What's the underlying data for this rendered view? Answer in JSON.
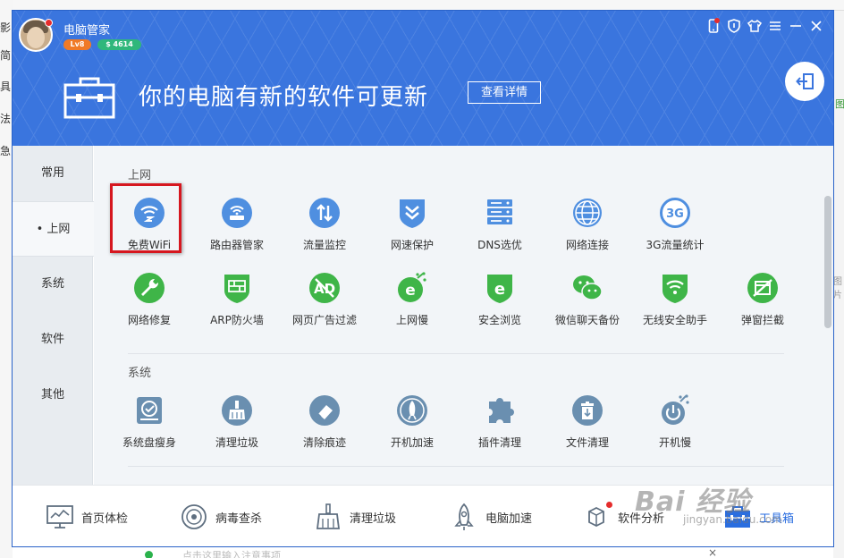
{
  "background": {
    "left_chars": [
      "影",
      "简",
      "具",
      "法",
      "急"
    ],
    "right_chars": [
      "图",
      "图片"
    ],
    "bottom_input_placeholder": "点击这里输入注意事项",
    "bottom_close": "×"
  },
  "header": {
    "app_title": "电脑管家",
    "level": "Lv8",
    "coins": "$ 4614",
    "banner_text": "你的电脑有新的软件可更新",
    "detail_button": "查看详情",
    "window_controls": [
      "phone-icon",
      "shield-icon",
      "skin-icon",
      "menu-icon",
      "minimize-icon",
      "close-icon"
    ]
  },
  "sidebar": {
    "tabs": [
      {
        "label": "常用",
        "active": false
      },
      {
        "label": "• 上网",
        "active": true
      },
      {
        "label": "系统",
        "active": false
      },
      {
        "label": "软件",
        "active": false
      },
      {
        "label": "其他",
        "active": false
      }
    ]
  },
  "content": {
    "sections": [
      {
        "title": "上网",
        "items": [
          {
            "label": "免费WiFi",
            "icon": "wifi-icon"
          },
          {
            "label": "路由器管家",
            "icon": "router-icon"
          },
          {
            "label": "流量监控",
            "icon": "traffic-icon"
          },
          {
            "label": "网速保护",
            "icon": "speed-shield-icon"
          },
          {
            "label": "DNS选优",
            "icon": "dns-server-icon"
          },
          {
            "label": "网络连接",
            "icon": "globe-icon"
          },
          {
            "label": "3G流量统计",
            "icon": "3g-icon"
          },
          {
            "label": "网络修复",
            "icon": "wrench-icon"
          },
          {
            "label": "ARP防火墙",
            "icon": "firewall-icon"
          },
          {
            "label": "网页广告过滤",
            "icon": "adblock-icon"
          },
          {
            "label": "上网慢",
            "icon": "slow-browser-icon"
          },
          {
            "label": "安全浏览",
            "icon": "safe-browser-icon"
          },
          {
            "label": "微信聊天备份",
            "icon": "wechat-icon"
          },
          {
            "label": "无线安全助手",
            "icon": "wifi-shield-icon"
          },
          {
            "label": "弹窗拦截",
            "icon": "popup-block-icon"
          }
        ]
      },
      {
        "title": "系统",
        "items": [
          {
            "label": "系统盘瘦身",
            "icon": "disk-slim-icon"
          },
          {
            "label": "清理垃圾",
            "icon": "broom-icon"
          },
          {
            "label": "清除痕迹",
            "icon": "eraser-icon"
          },
          {
            "label": "开机加速",
            "icon": "rocket-icon"
          },
          {
            "label": "插件清理",
            "icon": "puzzle-icon"
          },
          {
            "label": "文件清理",
            "icon": "trash-icon"
          },
          {
            "label": "开机慢",
            "icon": "power-slow-icon"
          }
        ]
      }
    ]
  },
  "bottom_nav": [
    {
      "label": "首页体检",
      "icon": "monitor-check-icon",
      "active": false
    },
    {
      "label": "病毒查杀",
      "icon": "virus-scan-icon",
      "active": false
    },
    {
      "label": "清理垃圾",
      "icon": "broom-icon",
      "active": false
    },
    {
      "label": "电脑加速",
      "icon": "rocket-icon",
      "active": false
    },
    {
      "label": "软件分析",
      "icon": "software-icon",
      "active": false
    },
    {
      "label": "工具箱",
      "icon": "toolbox-icon",
      "active": true
    }
  ],
  "watermark": {
    "text": "Bai 经验",
    "sub": "jingyan.baidu.com"
  },
  "colors": {
    "header_blue": "#3a75de",
    "icon_blue": "#4f8fe0",
    "icon_green": "#3fb548",
    "icon_grayblue": "#6a8fb0",
    "highlight_red": "#d6171f"
  }
}
